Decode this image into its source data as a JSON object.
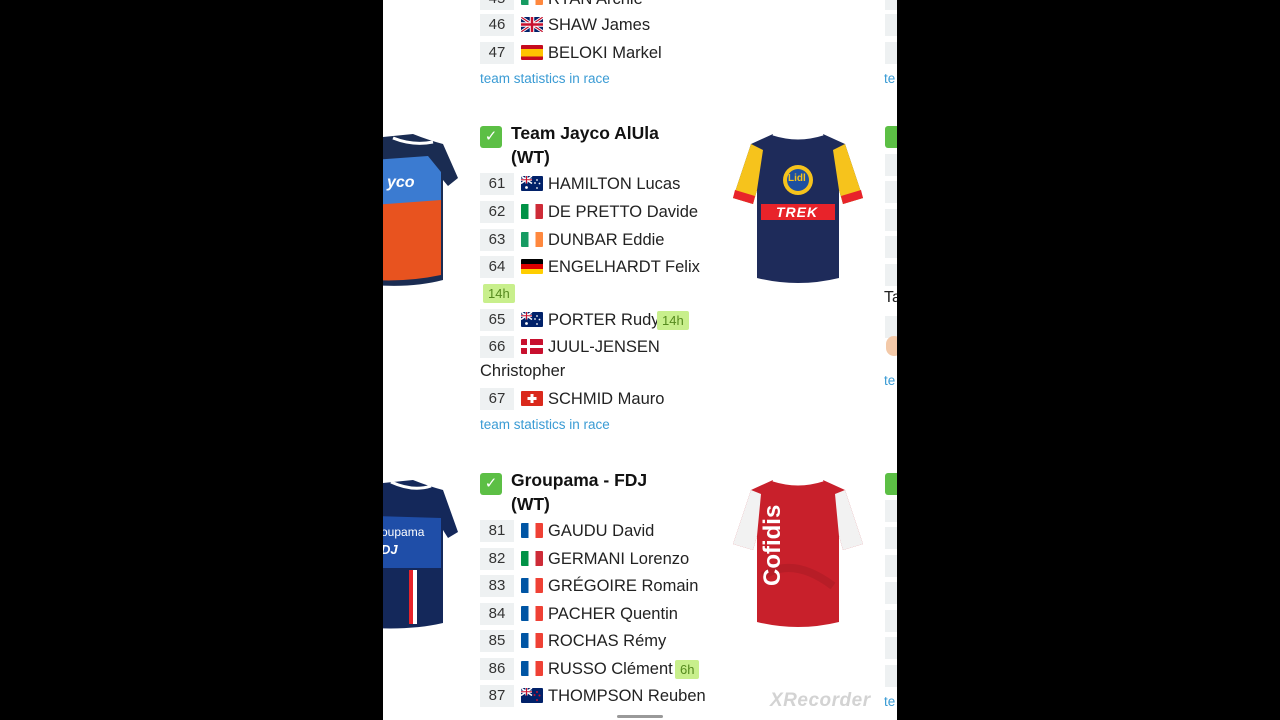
{
  "top_partial": {
    "name": "RYAN Archie"
  },
  "team_prev": {
    "riders": [
      {
        "number": "46",
        "name": "SHAW James",
        "flag": "flag-gb-icon"
      },
      {
        "number": "47",
        "name": "BELOKI Markel",
        "flag": "flag-es-icon"
      }
    ],
    "stats_link": "team statistics in race"
  },
  "team_jayco": {
    "name_line1": "Team Jayco AlUla",
    "name_line2": "(WT)",
    "riders": [
      {
        "number": "61",
        "name": "HAMILTON Lucas",
        "flag": "flag-au-icon"
      },
      {
        "number": "62",
        "name": "DE PRETTO Davide",
        "flag": "flag-it-icon"
      },
      {
        "number": "63",
        "name": "DUNBAR Eddie",
        "flag": "flag-ie-icon"
      },
      {
        "number": "64",
        "name": "ENGELHARDT Felix",
        "flag": "flag-de-icon",
        "badge": "14h"
      },
      {
        "number": "65",
        "name": "PORTER Rudy",
        "flag": "flag-au-icon",
        "badge": "14h"
      },
      {
        "number": "66",
        "name": "JUUL-JENSEN",
        "name_wrap": "Christopher",
        "flag": "flag-dk-icon"
      },
      {
        "number": "67",
        "name": "SCHMID Mauro",
        "flag": "flag-ch-icon"
      }
    ],
    "stats_link": "team statistics in race"
  },
  "team_fdj": {
    "name_line1": "Groupama - FDJ",
    "name_line2": "(WT)",
    "riders": [
      {
        "number": "81",
        "name": "GAUDU David",
        "flag": "flag-fr-icon"
      },
      {
        "number": "82",
        "name": "GERMANI Lorenzo",
        "flag": "flag-it-icon"
      },
      {
        "number": "83",
        "name": "GRÉGOIRE Romain",
        "flag": "flag-fr-icon"
      },
      {
        "number": "84",
        "name": "PACHER Quentin",
        "flag": "flag-fr-icon"
      },
      {
        "number": "85",
        "name": "ROCHAS Rémy",
        "flag": "flag-fr-icon"
      },
      {
        "number": "86",
        "name": "RUSSO Clément",
        "flag": "flag-fr-icon",
        "badge": "6h"
      },
      {
        "number": "87",
        "name": "THOMPSON Reuben",
        "flag": "flag-nz-icon"
      }
    ]
  },
  "jerseys": {
    "lidl_trek_text": "TREK",
    "lidl_text": "Lidl",
    "cofidis_text": "Cofidis",
    "jayco_text": "yco",
    "groupama_text": "oupama",
    "fdj_text": "DJ"
  },
  "right_column": {
    "partial_text": "Ta",
    "partial_link_1": "te",
    "partial_link_2": "te",
    "partial_link_3": "te"
  },
  "watermark": "XRecorder",
  "colors": {
    "link": "#3a9bd4",
    "check": "#5cbf45",
    "badge_bg": "#c8ef8c",
    "number_bg": "#eef1f2"
  }
}
